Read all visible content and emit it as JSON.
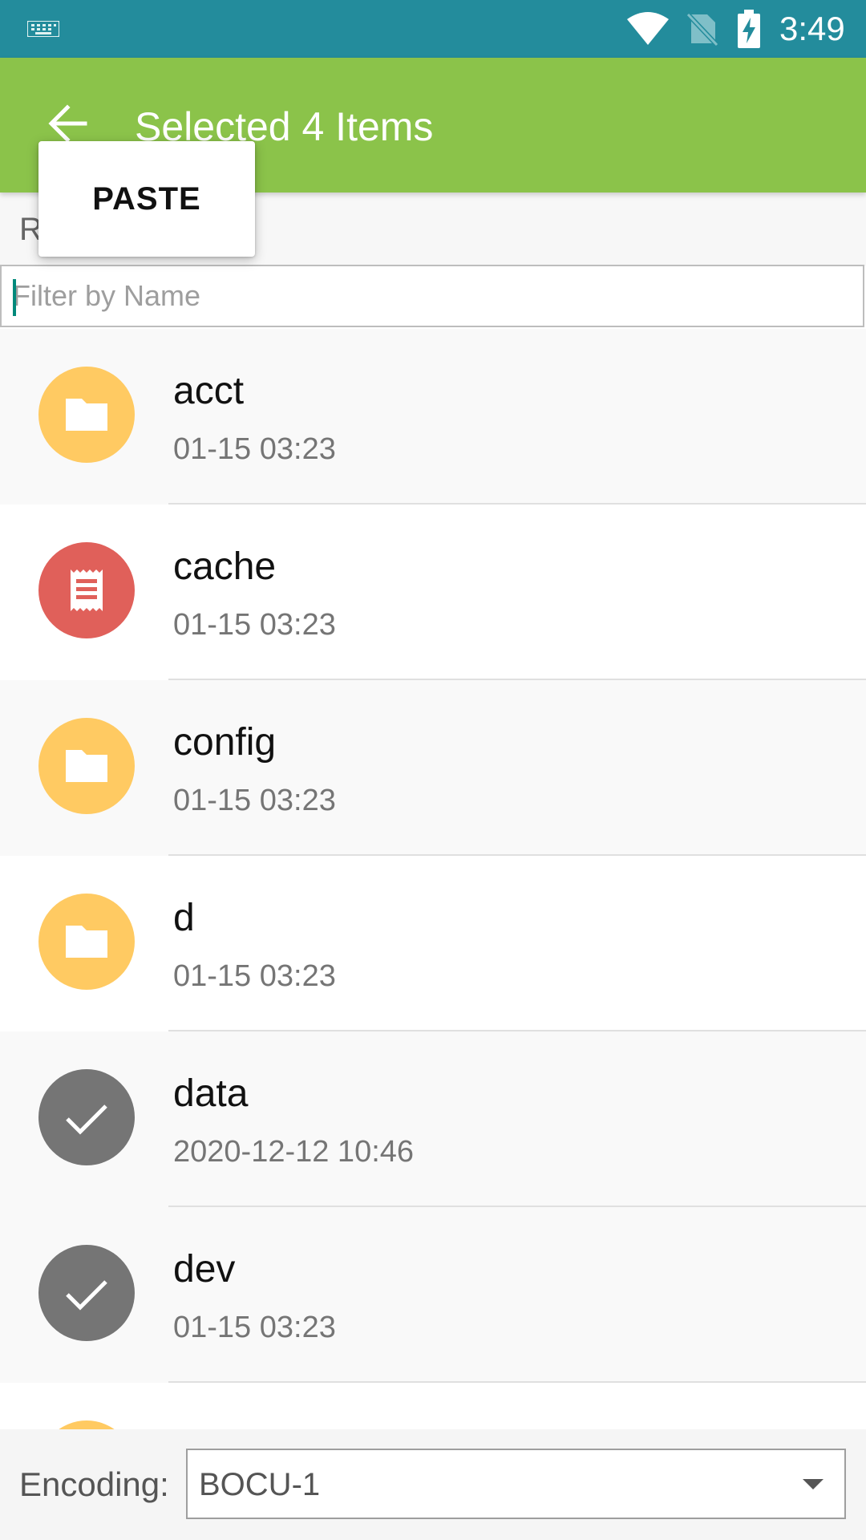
{
  "status_bar": {
    "time": "3:49",
    "icons": [
      "keyboard-icon",
      "wifi-icon",
      "no-sim-icon",
      "battery-charging-icon"
    ]
  },
  "app_bar": {
    "title": "Selected 4 Items",
    "back_icon": "arrow-back-icon"
  },
  "popup_menu": {
    "items": [
      {
        "label": "PASTE"
      }
    ]
  },
  "path_row": {
    "text": "R"
  },
  "filter": {
    "placeholder": "Filter by Name",
    "value": ""
  },
  "colors": {
    "status_bar": "#238c9c",
    "app_bar": "#8bc34a",
    "folder": "#ffca62",
    "file_red": "#e0605a",
    "selected": "#757575"
  },
  "files": [
    {
      "name": "acct",
      "date": "01-15 03:23",
      "icon": "folder-icon",
      "selected": false
    },
    {
      "name": "cache",
      "date": "01-15 03:23",
      "icon": "document-icon",
      "selected": false
    },
    {
      "name": "config",
      "date": "01-15 03:23",
      "icon": "folder-icon",
      "selected": false
    },
    {
      "name": "d",
      "date": "01-15 03:23",
      "icon": "folder-icon",
      "selected": false
    },
    {
      "name": "data",
      "date": "2020-12-12 10:46",
      "icon": "check-icon",
      "selected": true
    },
    {
      "name": "dev",
      "date": "01-15 03:23",
      "icon": "check-icon",
      "selected": true
    },
    {
      "name": "",
      "date": "",
      "icon": "folder-icon",
      "selected": false
    }
  ],
  "encoding": {
    "label": "Encoding:",
    "value": "BOCU-1"
  }
}
